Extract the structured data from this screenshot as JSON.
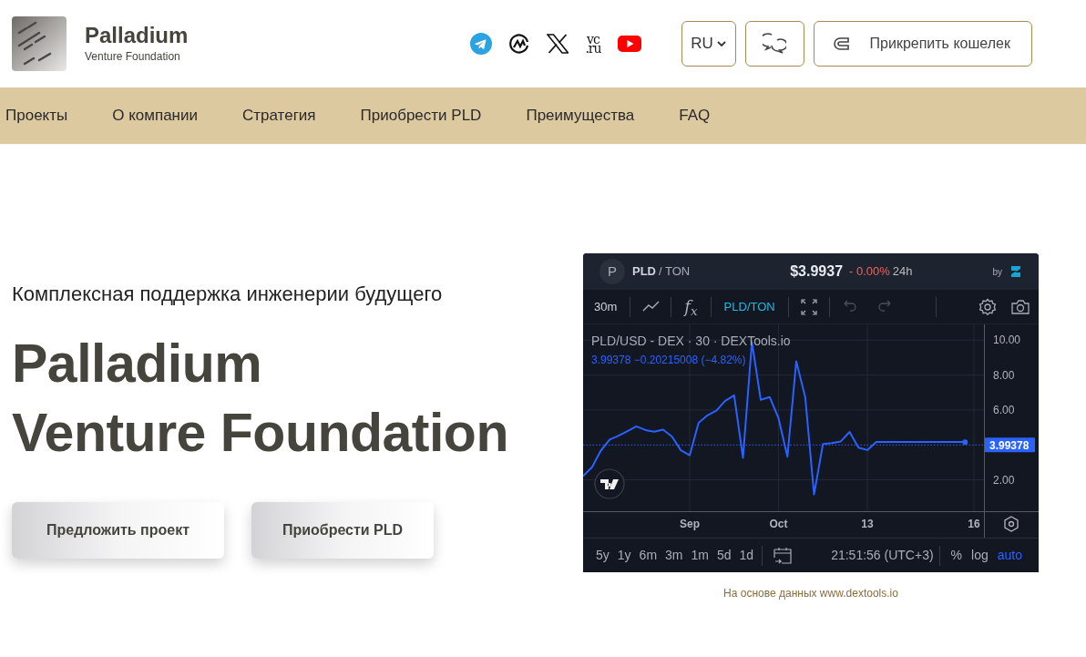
{
  "brand": {
    "name": "Palladium",
    "tagline": "Venture Foundation"
  },
  "socials": [
    {
      "kind": "telegram"
    },
    {
      "kind": "coinmarketcap"
    },
    {
      "kind": "x"
    },
    {
      "kind": "vc",
      "lines": [
        "vc",
        ".ru"
      ]
    },
    {
      "kind": "youtube"
    }
  ],
  "language": "RU",
  "wallet_button": "Прикрепить кошелек",
  "nav": [
    "Проекты",
    "О компании",
    "Стратегия",
    "Приобрести PLD",
    "Преимущества",
    "FAQ"
  ],
  "hero": {
    "subtitle": "Комплексная поддержка инженерии будущего",
    "title_lines": [
      "Palladium",
      "Venture Foundation"
    ],
    "buttons": [
      "Предложить проект",
      "Приобрести PLD"
    ]
  },
  "widget": {
    "avatar": "P",
    "pair_base": "PLD",
    "pair_quote": "/ TON",
    "price": "$3.9937",
    "change": "- 0.00%",
    "period": "24h",
    "by": "by",
    "toolbar": [
      {
        "kind": "text",
        "label": "30m",
        "active": false
      },
      {
        "kind": "line"
      },
      {
        "kind": "indicator",
        "label": "f$_{x}$"
      },
      {
        "kind": "text",
        "label": "PLD/TON",
        "active": true
      },
      {
        "kind": "fullscreen"
      },
      {
        "kind": "undo"
      },
      {
        "kind": "redo"
      },
      {
        "kind": "spacer"
      },
      {
        "kind": "settings"
      },
      {
        "kind": "camera"
      }
    ],
    "legend_title": "PLD/USD - DEX · 30 · DEXTools.io",
    "legend_values": "3.99378  −0.20215008 (−4.82%)",
    "chart_data": {
      "type": "line",
      "grid": true,
      "ref_lines": [
        {
          "axis": "y",
          "value": 3.99378,
          "label": "3.99378",
          "color": "#2962ff"
        }
      ],
      "ylim": [
        0.2,
        10.9
      ],
      "yticks": [
        {
          "value": 2,
          "label": "2.00"
        },
        {
          "value": 6,
          "label": "6.00"
        },
        {
          "value": 8,
          "label": "8.00"
        },
        {
          "value": 10,
          "label": "10.00"
        }
      ],
      "categories": [
        null,
        null,
        null,
        null,
        null,
        null,
        null,
        null,
        null,
        null,
        null,
        null,
        "Sep",
        null,
        null,
        null,
        null,
        null,
        null,
        null,
        null,
        null,
        "Oct",
        null,
        null,
        null,
        null,
        null,
        null,
        null,
        null,
        null,
        "13",
        null,
        null,
        null,
        null,
        null,
        null,
        null,
        null,
        null,
        null,
        null,
        "16"
      ],
      "series": [
        {
          "color": "#2962ff",
          "values": [
            2.21,
            2.72,
            3.67,
            4.3,
            4.52,
            4.79,
            5.06,
            4.85,
            4.75,
            4.87,
            4.48,
            3.69,
            3.4,
            5.26,
            5.69,
            5.96,
            6.52,
            6.84,
            3.26,
            9.89,
            6.58,
            6.74,
            5.53,
            3.32,
            8.79,
            6.74,
            1.16,
            4.05,
            4.1,
            4.2,
            4.74,
            3.84,
            3.7,
            4.16,
            4.16,
            4.16,
            4.16,
            4.16,
            4.16,
            4.16,
            4.16,
            4.16,
            4.16,
            4.16,
            null
          ]
        }
      ]
    },
    "ranges": [
      {
        "label": "5y",
        "selected": false
      },
      {
        "label": "1y",
        "selected": false
      },
      {
        "label": "6m",
        "selected": false
      },
      {
        "label": "3m",
        "selected": false
      },
      {
        "label": "1m",
        "selected": false
      },
      {
        "label": "5d",
        "selected": false
      },
      {
        "label": "1d",
        "selected": false
      }
    ],
    "clock": "21:51:56 (UTC+3)",
    "scale_options": [
      {
        "label": "%",
        "selected": false
      },
      {
        "label": "log",
        "selected": false
      },
      {
        "label": "auto",
        "selected": true
      }
    ]
  },
  "caption": "На основе данных www.dextools.io"
}
